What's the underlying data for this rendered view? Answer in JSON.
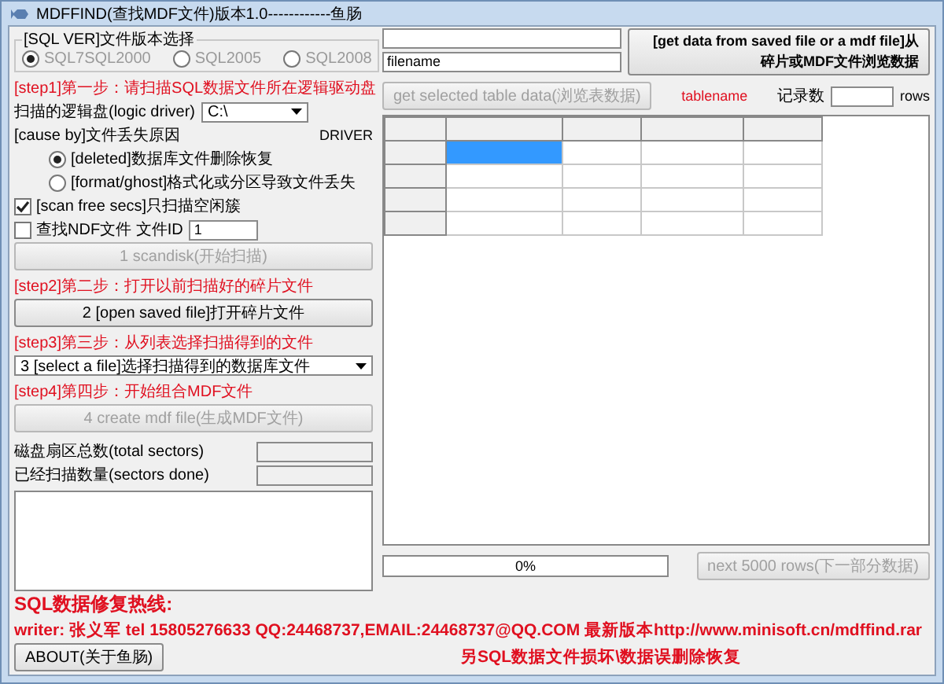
{
  "window": {
    "title": "MDFFIND(查找MDF文件)版本1.0------------鱼肠"
  },
  "left": {
    "version_group": {
      "label": "[SQL VER]文件版本选择",
      "disabled": true,
      "options": [
        {
          "label": "SQL7SQL2000",
          "selected": true
        },
        {
          "label": "SQL2005",
          "selected": false
        },
        {
          "label": "SQL2008",
          "selected": false
        }
      ]
    },
    "step1": "[step1]第一步：请扫描SQL数据文件所在逻辑驱动盘",
    "drive": {
      "label": "扫描的逻辑盘(logic driver)",
      "value": "C:\\"
    },
    "driver_label": "DRIVER",
    "cause": {
      "label": "[cause by]文件丢失原因",
      "options": [
        {
          "label": "[deleted]数据库文件删除恢复",
          "selected": true
        },
        {
          "label": "[format/ghost]格式化或分区导致文件丢失",
          "selected": false
        }
      ]
    },
    "scan_free": {
      "label": "[scan free secs]只扫描空闲簇",
      "checked": true
    },
    "find_ndf": {
      "label": "查找NDF文件 文件ID",
      "checked": false,
      "value": "1"
    },
    "scan_button": {
      "label": "1 scandisk(开始扫描)",
      "disabled": true
    },
    "step2": "[step2]第二步：打开以前扫描好的碎片文件",
    "open_button": {
      "label": "2 [open saved file]打开碎片文件",
      "disabled": false
    },
    "step3": "[step3]第三步：从列表选择扫描得到的文件",
    "file_select": {
      "value": "3 [select a file]选择扫描得到的数据库文件"
    },
    "step4": "[step4]第四步：开始组合MDF文件",
    "create_button": {
      "label": "4 create mdf file(生成MDF文件)",
      "disabled": true
    },
    "total_sectors": {
      "label": "磁盘扇区总数(total sectors)"
    },
    "sectors_done": {
      "label": "已经扫描数量(sectors done)"
    }
  },
  "right": {
    "get_data_button": {
      "label": "[get data from saved file or a mdf file]从碎片或MDF文件浏览数据",
      "disabled": false
    },
    "filename": {
      "value": "filename"
    },
    "table_data_button": {
      "label": "get selected table data(浏览表数据)",
      "disabled": true
    },
    "tablename": "tablename",
    "records": {
      "label": "记录数",
      "unit": "rows"
    },
    "grid": {
      "rows": [
        {
          "cells": [
            {
              "selected": true
            },
            {
              "selected": false
            },
            {
              "selected": false
            },
            {
              "selected": false
            }
          ]
        },
        {
          "cells": [
            {
              "selected": false
            },
            {
              "selected": false
            },
            {
              "selected": false
            },
            {
              "selected": false
            }
          ]
        },
        {
          "cells": [
            {
              "selected": false
            },
            {
              "selected": false
            },
            {
              "selected": false
            },
            {
              "selected": false
            }
          ]
        },
        {
          "cells": [
            {
              "selected": false
            },
            {
              "selected": false
            },
            {
              "selected": false
            },
            {
              "selected": false
            }
          ]
        }
      ]
    },
    "progress": {
      "label": "0%",
      "level": 0
    },
    "next_button": {
      "label": "next 5000 rows(下一部分数据)",
      "disabled": true
    }
  },
  "footer": {
    "hotline": "SQL数据修复热线:",
    "writer": "writer: 张义军 tel 15805276633 QQ:24468737,EMAIL:24468737@QQ.COM 最新版本http://www.minisoft.cn/mdffind.rar",
    "about_button": "ABOUT(关于鱼肠)",
    "notice": "另SQL数据文件损坏\\数据误删除恢复"
  }
}
